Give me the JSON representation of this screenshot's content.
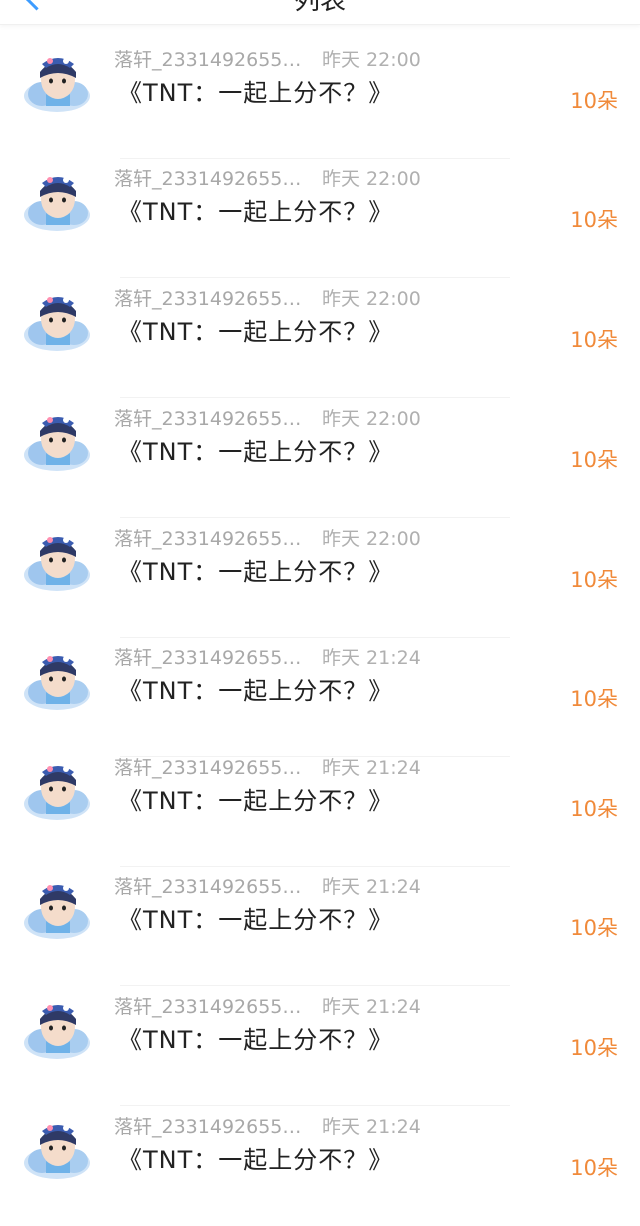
{
  "header": {
    "title": "列表"
  },
  "items": [
    {
      "name": "落轩_2331492655…",
      "time": "昨天 22:00",
      "message": "《TNT：一起上分不？》",
      "gift": "10朵"
    },
    {
      "name": "落轩_2331492655…",
      "time": "昨天 22:00",
      "message": "《TNT：一起上分不？》",
      "gift": "10朵"
    },
    {
      "name": "落轩_2331492655…",
      "time": "昨天 22:00",
      "message": "《TNT：一起上分不？》",
      "gift": "10朵"
    },
    {
      "name": "落轩_2331492655…",
      "time": "昨天 22:00",
      "message": "《TNT：一起上分不？》",
      "gift": "10朵"
    },
    {
      "name": "落轩_2331492655…",
      "time": "昨天 22:00",
      "message": "《TNT：一起上分不？》",
      "gift": "10朵"
    },
    {
      "name": "落轩_2331492655…",
      "time": "昨天 21:24",
      "message": "《TNT：一起上分不？》",
      "gift": "10朵"
    },
    {
      "name": "落轩_2331492655…",
      "time": "昨天 21:24",
      "message": "《TNT：一起上分不？》",
      "gift": "10朵"
    },
    {
      "name": "落轩_2331492655…",
      "time": "昨天 21:24",
      "message": "《TNT：一起上分不？》",
      "gift": "10朵"
    },
    {
      "name": "落轩_2331492655…",
      "time": "昨天 21:24",
      "message": "《TNT：一起上分不？》",
      "gift": "10朵"
    },
    {
      "name": "落轩_2331492655…",
      "time": "昨天 21:24",
      "message": "《TNT：一起上分不？》",
      "gift": "10朵"
    }
  ],
  "colors": {
    "accent": "#3d9cff",
    "gift_text": "#f08a3a",
    "muted_text": "#a8a8a8"
  },
  "icons": {
    "back": "chevron-left-icon",
    "avatar": "avatar-cartoon"
  }
}
